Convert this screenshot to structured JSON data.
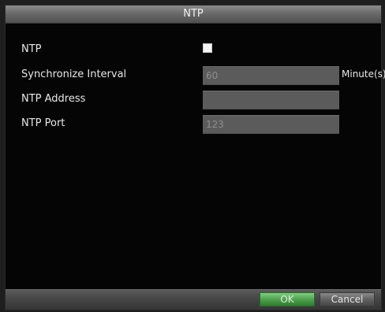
{
  "dialog": {
    "title": "NTP"
  },
  "form": {
    "ntp": {
      "label": "NTP",
      "checked": false
    },
    "sync_interval": {
      "label": "Synchronize Interval",
      "value": "60",
      "unit": "Minute(s)"
    },
    "ntp_address": {
      "label": "NTP Address",
      "value": ""
    },
    "ntp_port": {
      "label": "NTP Port",
      "value": "123"
    }
  },
  "buttons": {
    "ok_label": "OK",
    "cancel_label": "Cancel"
  },
  "colors": {
    "ok_button": "#4a9f4a",
    "cancel_button": "#5e5e5e",
    "field_bg": "#5b5b5b",
    "dialog_bg": "#050505"
  }
}
